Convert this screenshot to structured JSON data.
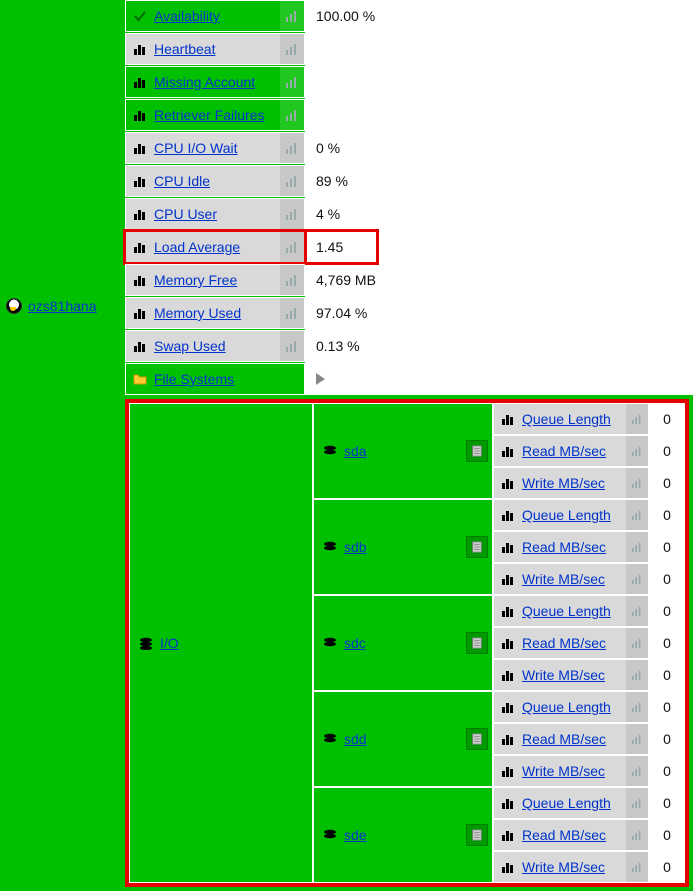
{
  "host": {
    "name": "ozs81hana"
  },
  "metrics": [
    {
      "key": "availability",
      "label": "Availability",
      "value": "100.00 %",
      "bg": "green",
      "icon": "check"
    },
    {
      "key": "heartbeat",
      "label": "Heartbeat",
      "value": "",
      "bg": "grey",
      "icon": "bars"
    },
    {
      "key": "missing_account",
      "label": "Missing Account",
      "value": "",
      "bg": "green",
      "icon": "bars"
    },
    {
      "key": "retriever_failures",
      "label": "Retriever Failures",
      "value": "",
      "bg": "green",
      "icon": "bars"
    },
    {
      "key": "cpu_io_wait",
      "label": "CPU I/O Wait",
      "value": "0 %",
      "bg": "grey",
      "icon": "bars"
    },
    {
      "key": "cpu_idle",
      "label": "CPU Idle",
      "value": "89 %",
      "bg": "grey",
      "icon": "bars"
    },
    {
      "key": "cpu_user",
      "label": "CPU User",
      "value": "4 %",
      "bg": "grey",
      "icon": "bars"
    },
    {
      "key": "load_average",
      "label": "Load Average",
      "value": "1.45",
      "bg": "grey",
      "icon": "bars",
      "highlight": true
    },
    {
      "key": "memory_free",
      "label": "Memory Free",
      "value": "4,769 MB",
      "bg": "grey",
      "icon": "bars"
    },
    {
      "key": "memory_used",
      "label": "Memory Used",
      "value": "97.04 %",
      "bg": "grey",
      "icon": "bars"
    },
    {
      "key": "swap_used",
      "label": "Swap Used",
      "value": "0.13 %",
      "bg": "grey",
      "icon": "bars"
    },
    {
      "key": "file_systems",
      "label": "File Systems",
      "value": "",
      "bg": "green",
      "icon": "folder",
      "arrow": true
    }
  ],
  "io": {
    "label": "I/O",
    "disks": [
      {
        "name": "sda",
        "metrics": [
          {
            "label": "Queue Length",
            "value": "0"
          },
          {
            "label": "Read MB/sec",
            "value": "0"
          },
          {
            "label": "Write MB/sec",
            "value": "0"
          }
        ]
      },
      {
        "name": "sdb",
        "metrics": [
          {
            "label": "Queue Length",
            "value": "0"
          },
          {
            "label": "Read MB/sec",
            "value": "0"
          },
          {
            "label": "Write MB/sec",
            "value": "0"
          }
        ]
      },
      {
        "name": "sdc",
        "metrics": [
          {
            "label": "Queue Length",
            "value": "0"
          },
          {
            "label": "Read MB/sec",
            "value": "0"
          },
          {
            "label": "Write MB/sec",
            "value": "0"
          }
        ]
      },
      {
        "name": "sdd",
        "metrics": [
          {
            "label": "Queue Length",
            "value": "0"
          },
          {
            "label": "Read MB/sec",
            "value": "0"
          },
          {
            "label": "Write MB/sec",
            "value": "0"
          }
        ]
      },
      {
        "name": "sde",
        "metrics": [
          {
            "label": "Queue Length",
            "value": "0"
          },
          {
            "label": "Read MB/sec",
            "value": "0"
          },
          {
            "label": "Write MB/sec",
            "value": "0"
          }
        ]
      }
    ]
  }
}
